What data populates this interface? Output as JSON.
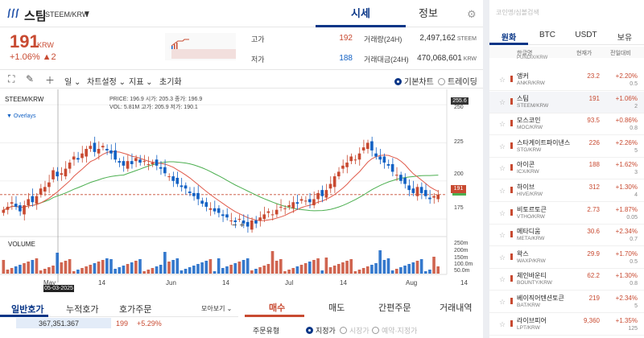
{
  "header": {
    "coin_name": "스팀",
    "pair": "STEEM/KRW",
    "tab_sise": "시세",
    "tab_info": "정보"
  },
  "price": {
    "current": "191",
    "unit": "KRW",
    "change": "+1.06%  ▲2",
    "high_label": "고가",
    "high_value": "192",
    "low_label": "저가",
    "low_value": "188",
    "volume_label": "거래량(24H)",
    "volume_value": "2,497,162",
    "volume_unit": "STEEM",
    "amount_label": "거래대금(24H)",
    "amount_value": "470,068,601",
    "amount_unit": "KRW"
  },
  "toolbar": {
    "period": "일",
    "chart_settings": "차트설정",
    "indicator": "지표",
    "reset": "초기화",
    "basic_chart": "기본차트",
    "tradingview": "트레이딩뷰"
  },
  "chart_legend": {
    "symbol": "STEEM/KRW",
    "overlays": "Overlays",
    "price_row": "PRICE:  196.9   시가:  205.3   종가:  196.9",
    "vol_row": "VOL:    5.81M   고가:  205.9   저가:  190.1",
    "volume_title": "VOLUME"
  },
  "chart_data": {
    "type": "line",
    "y_ticks": [
      "250",
      "225",
      "200",
      "175"
    ],
    "vol_ticks": [
      "250m",
      "200m",
      "150m",
      "100.0m",
      "50.0m"
    ],
    "x_ticks": [
      "May",
      "14",
      "Jun",
      "14",
      "Jul",
      "14",
      "Aug",
      "14"
    ],
    "last_price_tag": "191",
    "crosshair_price": "255.6",
    "crosshair_date": "05-03-2025",
    "ylim": [
      165,
      258
    ],
    "closes": [
      181,
      183,
      186,
      183,
      180,
      184,
      188,
      186,
      190,
      195,
      196,
      199,
      207,
      203,
      205,
      208,
      212,
      216,
      214,
      218,
      221,
      223,
      219,
      221,
      223,
      220,
      218,
      214,
      212,
      210,
      213,
      211,
      215,
      212,
      213,
      211,
      212,
      210,
      208,
      205,
      203,
      200,
      198,
      196,
      195,
      192,
      190,
      188,
      185,
      183,
      182,
      180,
      179,
      177,
      176,
      174,
      173,
      175,
      172,
      170,
      174,
      172,
      176,
      178,
      180,
      178,
      181,
      183,
      182,
      184,
      186,
      185,
      188,
      187,
      186,
      188,
      192,
      190,
      194,
      198,
      203,
      206,
      210,
      212,
      216,
      214,
      218,
      222,
      225,
      220,
      216,
      214,
      212,
      210,
      206,
      204,
      200,
      198,
      194,
      192,
      196,
      192,
      190,
      188,
      190,
      191
    ]
  },
  "order_book": {
    "tab_general": "일반호가",
    "tab_cumulative": "누적호가",
    "tab_order": "호가주문",
    "view_mode": "모아보기",
    "row_qty": "367,351.367",
    "row_price": "199",
    "row_pct": "+5.29%"
  },
  "order": {
    "buy": "매수",
    "sell": "매도",
    "simple": "간편주문",
    "history": "거래내역",
    "type_label": "주문유형",
    "limit": "지정가",
    "market": "시장가",
    "reserve": "예약·지정가"
  },
  "side": {
    "search_placeholder": "코인명/심볼검색",
    "tabs": [
      "원화",
      "BTC",
      "USDT",
      "보유"
    ],
    "head_name": "한글명",
    "head_price": "현재가",
    "head_change": "전일대비",
    "partial_top": "PUNDIX/KRW",
    "coins": [
      {
        "name": "앵커",
        "pair": "ANKR/KRW",
        "price": "23.2",
        "pct": "+2.20%",
        "vol": "0.5"
      },
      {
        "name": "스팀",
        "pair": "STEEM/KRW",
        "price": "191",
        "pct": "+1.06%",
        "vol": "2"
      },
      {
        "name": "모스코인",
        "pair": "MOC/KRW",
        "price": "93.5",
        "pct": "+0.86%",
        "vol": "0.8"
      },
      {
        "name": "스타게이트파이낸스",
        "pair": "STG/KRW",
        "price": "226",
        "pct": "+2.26%",
        "vol": "5"
      },
      {
        "name": "아이콘",
        "pair": "ICX/KRW",
        "price": "188",
        "pct": "+1.62%",
        "vol": "3"
      },
      {
        "name": "하이브",
        "pair": "HIVE/KRW",
        "price": "312",
        "pct": "+1.30%",
        "vol": "4"
      },
      {
        "name": "비토르토큰",
        "pair": "VTHO/KRW",
        "price": "2.73",
        "pct": "+1.87%",
        "vol": "0.05"
      },
      {
        "name": "메타디움",
        "pair": "META/KRW",
        "price": "30.6",
        "pct": "+2.34%",
        "vol": "0.7"
      },
      {
        "name": "왁스",
        "pair": "WAXP/KRW",
        "price": "29.9",
        "pct": "+1.70%",
        "vol": "0.5"
      },
      {
        "name": "체인바운티",
        "pair": "BOUNTY/KRW",
        "price": "62.2",
        "pct": "+1.30%",
        "vol": "0.8"
      },
      {
        "name": "베이직어텐션토큰",
        "pair": "BAT/KRW",
        "price": "219",
        "pct": "+2.34%",
        "vol": "5"
      },
      {
        "name": "라이브피어",
        "pair": "LPT/KRW",
        "price": "9,360",
        "pct": "+1.35%",
        "vol": "125"
      }
    ]
  },
  "colors": {
    "up": "#c84a31",
    "down": "#1261c4",
    "accent": "#093687",
    "ma_red": "#e05a4a",
    "ma_green": "#4caf50"
  }
}
